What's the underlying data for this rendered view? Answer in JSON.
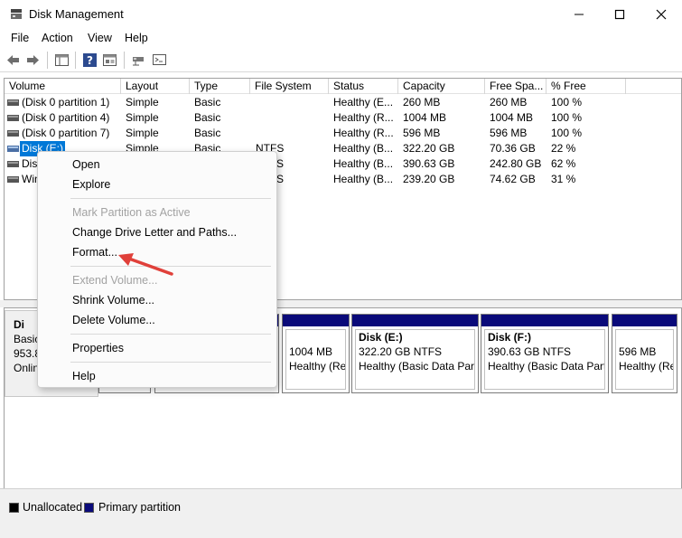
{
  "window": {
    "title": "Disk Management",
    "icon": "disk-management-icon"
  },
  "menu": [
    "File",
    "Action",
    "View",
    "Help"
  ],
  "toolbar": {
    "icons": [
      "back-arrow-icon",
      "forward-arrow-icon",
      "console-tree-icon",
      "help-icon",
      "properties-icon",
      "disk-icon",
      "volume-list-icon"
    ]
  },
  "volume_list": {
    "columns": [
      "Volume",
      "Layout",
      "Type",
      "File System",
      "Status",
      "Capacity",
      "Free Spa...",
      "% Free"
    ],
    "rows": [
      {
        "volume": "(Disk 0 partition 1)",
        "layout": "Simple",
        "type": "Basic",
        "fs": "",
        "status": "Healthy (E...",
        "capacity": "260 MB",
        "free": "260 MB",
        "pct": "100 %"
      },
      {
        "volume": "(Disk 0 partition 4)",
        "layout": "Simple",
        "type": "Basic",
        "fs": "",
        "status": "Healthy (R...",
        "capacity": "1004 MB",
        "free": "1004 MB",
        "pct": "100 %"
      },
      {
        "volume": "(Disk 0 partition 7)",
        "layout": "Simple",
        "type": "Basic",
        "fs": "",
        "status": "Healthy (R...",
        "capacity": "596 MB",
        "free": "596 MB",
        "pct": "100 %"
      },
      {
        "volume": "Disk (E:)",
        "layout": "Simple",
        "type": "Basic",
        "fs": "NTFS",
        "status": "Healthy (B...",
        "capacity": "322.20 GB",
        "free": "70.36 GB",
        "pct": "22 %"
      },
      {
        "volume": "Dis",
        "layout": "",
        "type": "",
        "fs": "S",
        "status": "Healthy (B...",
        "capacity": "390.63 GB",
        "free": "242.80 GB",
        "pct": "62 %"
      },
      {
        "volume": "Win",
        "layout": "",
        "type": "",
        "fs": "S",
        "status": "Healthy (B...",
        "capacity": "239.20 GB",
        "free": "74.62 GB",
        "pct": "31 %"
      }
    ],
    "selected_index": 3
  },
  "disk_map": {
    "disk": {
      "name": "Di",
      "type": "Basic",
      "size": "953.8",
      "status": "Onlin"
    },
    "partitions": [
      {
        "name": "",
        "line1": "1004 MB",
        "line2": "Healthy (Re"
      },
      {
        "name": "Disk  (E:)",
        "line1": "322.20 GB NTFS",
        "line2": "Healthy (Basic Data Part"
      },
      {
        "name": "Disk  (F:)",
        "line1": "390.63 GB NTFS",
        "line2": "Healthy (Basic Data Parti"
      },
      {
        "name": "",
        "line1": "596 MB",
        "line2": "Healthy (Re"
      }
    ]
  },
  "legend": [
    {
      "label": "Unallocated",
      "color": "#000000"
    },
    {
      "label": "Primary partition",
      "color": "#0a0a7a"
    }
  ],
  "context_menu": {
    "items": [
      {
        "label": "Open",
        "enabled": true
      },
      {
        "label": "Explore",
        "enabled": true
      },
      {
        "label": "Mark Partition as Active",
        "enabled": false
      },
      {
        "label": "Change Drive Letter and Paths...",
        "enabled": true
      },
      {
        "label": "Format...",
        "enabled": true
      },
      {
        "label": "Extend Volume...",
        "enabled": false
      },
      {
        "label": "Shrink Volume...",
        "enabled": true
      },
      {
        "label": "Delete Volume...",
        "enabled": true
      },
      {
        "label": "Properties",
        "enabled": true
      },
      {
        "label": "Help",
        "enabled": true
      }
    ]
  },
  "colors": {
    "selection": "#0078d7",
    "primary_partition": "#0a0a7a",
    "annotation_arrow": "#e0403a"
  }
}
